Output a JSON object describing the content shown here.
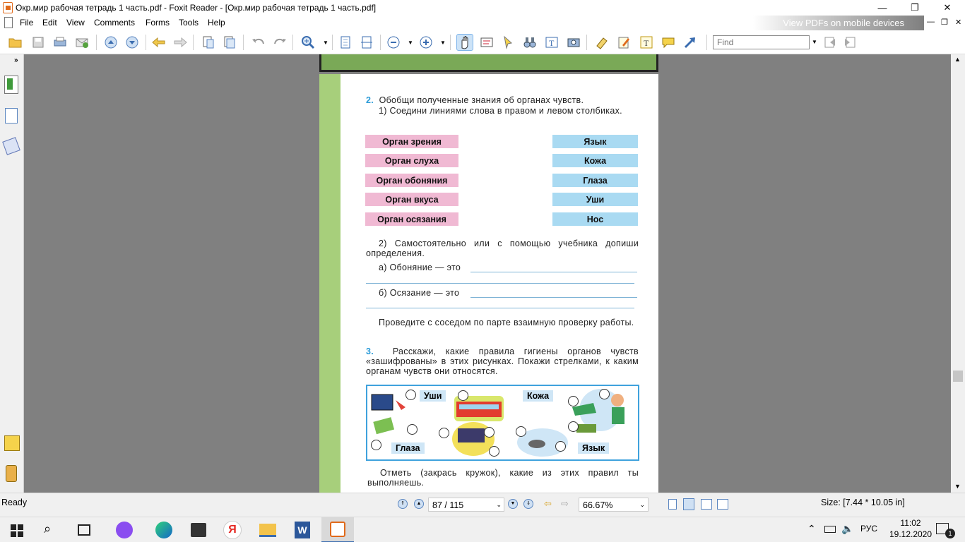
{
  "window": {
    "title": "Окр.мир рабочая тетрадь 1 часть.pdf - Foxit Reader - [Окр.мир рабочая тетрадь 1 часть.pdf]",
    "minimize": "—",
    "restore": "❐",
    "close": "✕"
  },
  "menu": [
    "File",
    "Edit",
    "View",
    "Comments",
    "Forms",
    "Tools",
    "Help"
  ],
  "ad_banner": "View PDFs on mobile devices",
  "find": {
    "placeholder": "Find"
  },
  "page": {
    "task2_num": "2.",
    "task2_title": "Обобщи полученные знания об органах чувств.",
    "task2_sub1": "1) Соедини линиями слова в правом и левом столбиках.",
    "left_labels": [
      "Орган зрения",
      "Орган слуха",
      "Орган обоняния",
      "Орган вкуса",
      "Орган осязания"
    ],
    "right_labels": [
      "Язык",
      "Кожа",
      "Глаза",
      "Уши",
      "Нос"
    ],
    "task2_sub2": "2) Самостоятельно или с помощью учебника допиши определения.",
    "def_a": "а) Обоняние — это",
    "def_b": "б) Осязание — это",
    "check": "Проведите с соседом по парте взаимную проверку работы.",
    "task3_num": "3.",
    "task3_text": "Расскажи, какие правила гигиены органов чувств «зашифрованы» в этих рисунках. Покажи стрелками, к каким органам чувств они относятся.",
    "pic_labels": {
      "ears": "Уши",
      "skin": "Кожа",
      "eyes": "Глаза",
      "tongue": "Язык"
    },
    "mark": "Отметь (закрась кружок), какие из этих правил ты выполняешь."
  },
  "status": {
    "ready": "Ready",
    "page_current": "87 / 115",
    "zoom": "66.67%",
    "size": "Size: [7.44 * 10.05 in]"
  },
  "taskbar": {
    "lang": "РУС",
    "time": "11:02",
    "date": "19.12.2020",
    "notif_count": "1"
  },
  "colors": {
    "accent": "#2b9bd8",
    "pink_label": "#f0b9d3",
    "blue_label": "#a9daf2",
    "viewer_bg": "#808080"
  }
}
